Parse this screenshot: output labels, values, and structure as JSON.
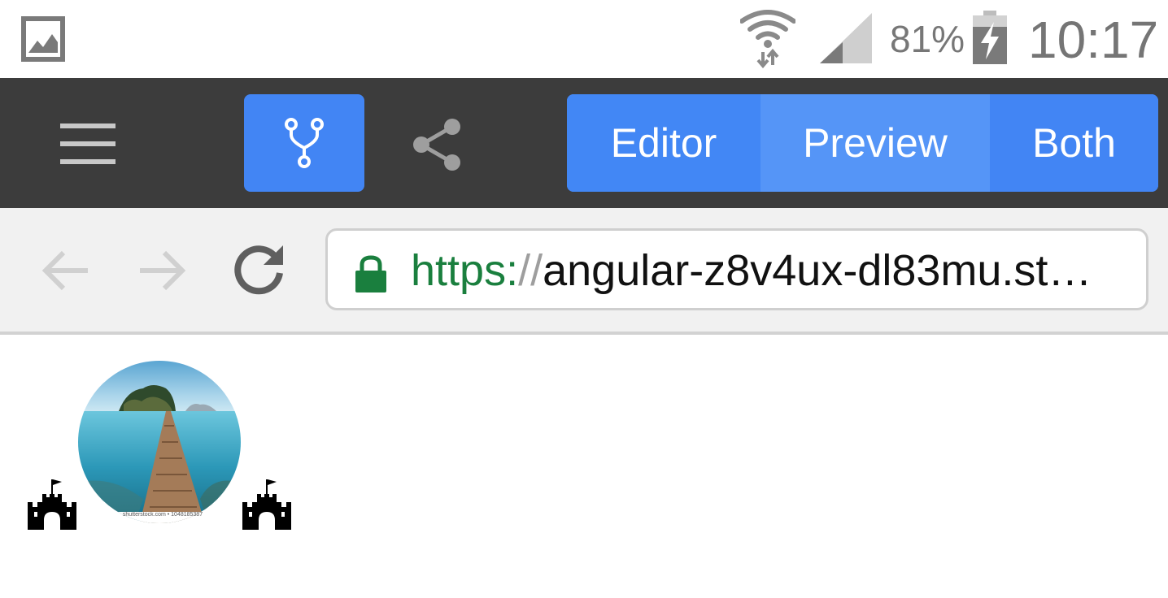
{
  "status_bar": {
    "notification_icon": "gallery-icon",
    "wifi_icon": "wifi-icon",
    "signal_icon": "cell-signal-icon",
    "battery_percent": "81%",
    "battery_icon": "battery-charging-icon",
    "time": "10:17"
  },
  "toolbar": {
    "menu_icon": "hamburger-menu-icon",
    "fork_icon": "fork-icon",
    "share_icon": "share-icon",
    "view_modes": [
      {
        "label": "Editor",
        "active": false
      },
      {
        "label": "Preview",
        "active": true
      },
      {
        "label": "Both",
        "active": false
      }
    ]
  },
  "browser": {
    "back_icon": "arrow-back-icon",
    "forward_icon": "arrow-forward-icon",
    "reload_icon": "reload-icon",
    "lock_icon": "lock-icon",
    "url_scheme": "https:",
    "url_separator": "//",
    "url_host": "angular-z8v4ux-dl83mu.st…"
  },
  "preview": {
    "image_icon": "castle-icon",
    "photo_watermark": "shutterstock.com • 1048185387"
  },
  "colors": {
    "toolbar_bg": "#3c3c3c",
    "accent_blue": "#4285f4",
    "active_segment": "#5595f7",
    "secure_green": "#1a7f3e"
  }
}
